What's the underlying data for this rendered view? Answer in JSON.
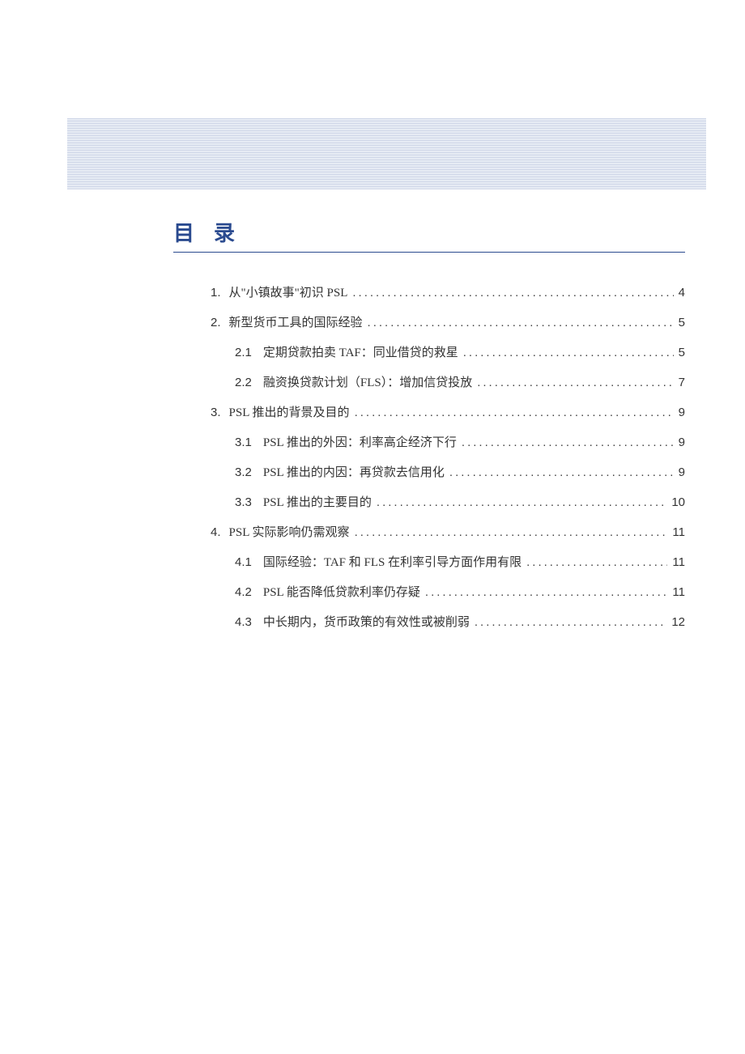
{
  "title": "目录",
  "toc": [
    {
      "level": 1,
      "num": "1.",
      "text": "从\"小镇故事\"初识 PSL",
      "page": "4"
    },
    {
      "level": 1,
      "num": "2.",
      "text": "新型货币工具的国际经验",
      "page": "5"
    },
    {
      "level": 2,
      "num": "2.1",
      "text": "定期贷款拍卖 TAF：同业借贷的救星",
      "page": "5"
    },
    {
      "level": 2,
      "num": "2.2",
      "text": "融资换贷款计划（FLS）：增加信贷投放",
      "page": "7"
    },
    {
      "level": 1,
      "num": "3.",
      "text": "PSL 推出的背景及目的",
      "page": "9"
    },
    {
      "level": 2,
      "num": "3.1",
      "text": "PSL 推出的外因：利率高企经济下行",
      "page": "9"
    },
    {
      "level": 2,
      "num": "3.2",
      "text": "PSL 推出的内因：再贷款去信用化",
      "page": "9"
    },
    {
      "level": 2,
      "num": "3.3",
      "text": "PSL 推出的主要目的",
      "page": "10"
    },
    {
      "level": 1,
      "num": "4.",
      "text": "PSL 实际影响仍需观察",
      "page": "11"
    },
    {
      "level": 2,
      "num": "4.1",
      "text": "国际经验：TAF 和 FLS 在利率引导方面作用有限",
      "page": "11"
    },
    {
      "level": 2,
      "num": "4.2",
      "text": "PSL 能否降低贷款利率仍存疑",
      "page": "11"
    },
    {
      "level": 2,
      "num": "4.3",
      "text": "中长期内，货币政策的有效性或被削弱",
      "page": "12"
    }
  ]
}
